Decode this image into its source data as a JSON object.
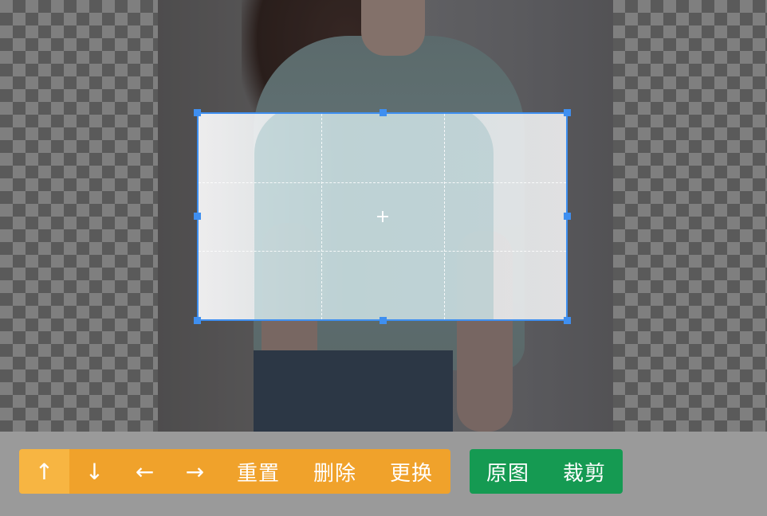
{
  "canvas": {
    "background": "checkerboard"
  },
  "toolbar": {
    "move_up_icon": "↑",
    "move_down_icon": "↓",
    "move_left_icon": "←",
    "move_right_icon": "→",
    "reset_label": "重置",
    "delete_label": "删除",
    "replace_label": "更换",
    "original_label": "原图",
    "crop_label": "裁剪"
  },
  "colors": {
    "accent_orange": "#f0a22b",
    "accent_orange_active": "#f7b542",
    "accent_green": "#159a52",
    "crop_border": "#3f8ff0"
  }
}
